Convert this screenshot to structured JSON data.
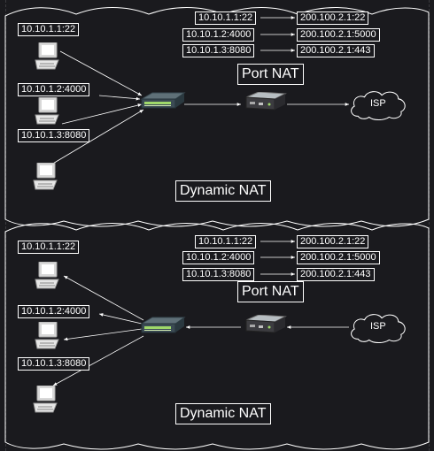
{
  "panels": [
    {
      "hosts": [
        "10.10.1.1:22",
        "10.10.1.2:4000",
        "10.10.1.3:8080"
      ],
      "mappings": [
        {
          "from": "10.10.1.1:22",
          "to": "200.100.2.1:22"
        },
        {
          "from": "10.10.1.2:4000",
          "to": "200.100.2.1:5000"
        },
        {
          "from": "10.10.1.3:8080",
          "to": "200.100.2.1:443"
        }
      ],
      "port_nat_label": "Port NAT",
      "dynamic_nat_label": "Dynamic NAT",
      "isp_label": "ISP"
    },
    {
      "hosts": [
        "10.10.1.1:22",
        "10.10.1.2:4000",
        "10.10.1.3:8080"
      ],
      "mappings": [
        {
          "from": "10.10.1.1:22",
          "to": "200.100.2.1:22"
        },
        {
          "from": "10.10.1.2:4000",
          "to": "200.100.2.1:5000"
        },
        {
          "from": "10.10.1.3:8080",
          "to": "200.100.2.1:443"
        }
      ],
      "port_nat_label": "Port NAT",
      "dynamic_nat_label": "Dynamic NAT",
      "isp_label": "ISP"
    }
  ]
}
